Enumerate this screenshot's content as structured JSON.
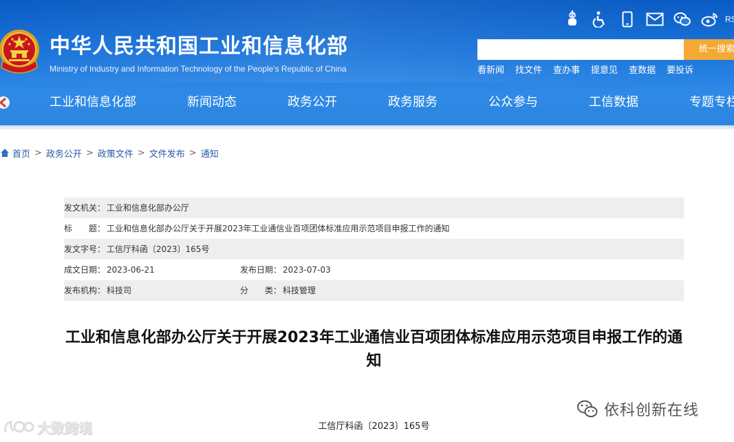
{
  "header": {
    "title_cn": "中华人民共和国工业和信息化部",
    "title_en": "Ministry of Industry and Information Technology of the People's Republic of China",
    "tool_icons": [
      "robot-icon",
      "accessibility-icon",
      "mobile-icon",
      "mail-icon",
      "wechat-icon",
      "weibo-icon"
    ],
    "rss_label": "RSS",
    "search": {
      "placeholder": "",
      "button_label": "统一搜索"
    },
    "quick_links": [
      "看新闻",
      "找文件",
      "查办事",
      "提意见",
      "查数据",
      "要投诉"
    ],
    "nav": [
      "工业和信息化部",
      "新闻动态",
      "政务公开",
      "政务服务",
      "公众参与",
      "工信数据",
      "专题专栏"
    ],
    "colors": {
      "header_blue": "#1a74da",
      "search_button": "#f5a935"
    }
  },
  "breadcrumb": [
    "首页",
    "政务公开",
    "政策文件",
    "文件发布",
    "通知"
  ],
  "info": {
    "issuer_label": "发文机关：",
    "issuer": "工业和信息化部办公厅",
    "title_label": "标　　题：",
    "title": "工业和信息化部办公厅关于开展2023年工业通信业百项团体标准应用示范项目申报工作的通知",
    "doc_no_label": "发文字号：",
    "doc_no": "工信厅科函〔2023〕165号",
    "written_label": "成文日期：",
    "written_date": "2023-06-21",
    "published_label": "发布日期：",
    "published_date": "2023-07-03",
    "agency_label": "发布机构：",
    "agency": "科技司",
    "category_label": "分　　类：",
    "category": "科技管理"
  },
  "article": {
    "title": "工业和信息化部办公厅关于开展2023年工业通信业百项团体标准应用示范项目申报工作的通知",
    "doc_number": "工信厅科函〔2023〕165号"
  },
  "watermarks": {
    "left": "大数跨境",
    "right": "依科创新在线"
  }
}
